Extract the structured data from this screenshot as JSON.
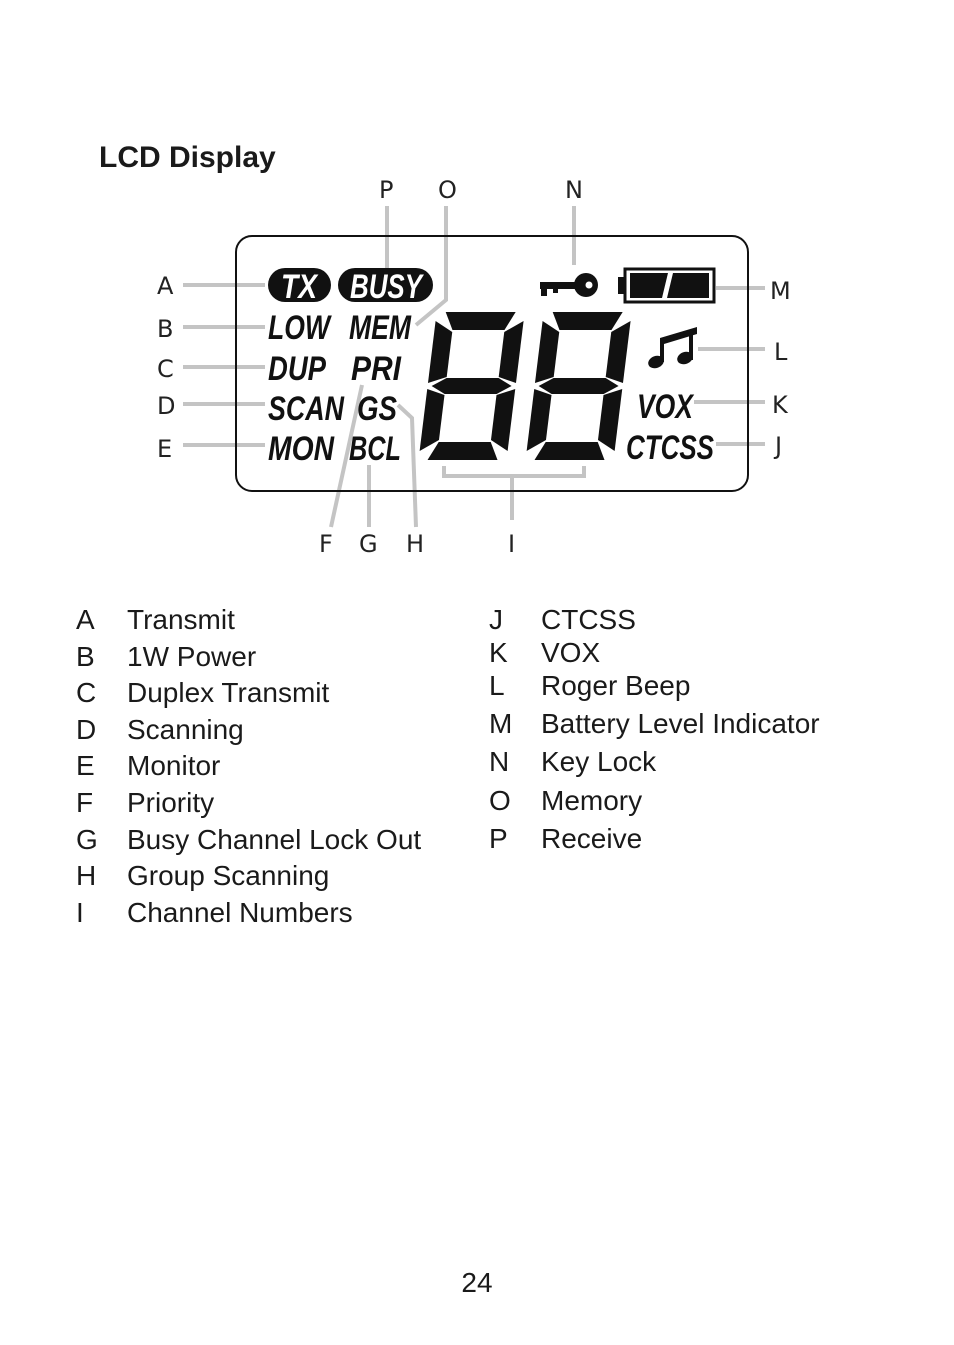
{
  "section_title": "LCD Display",
  "lcd": {
    "indicators": {
      "tx": "TX",
      "busy": "BUSY",
      "low": "LOW",
      "mem": "MEM",
      "dup": "DUP",
      "pri": "PRI",
      "scan": "SCAN",
      "gs": "GS",
      "mon": "MON",
      "bcl": "BCL",
      "vox": "VOX",
      "ctcss": "CTCSS"
    },
    "channel_digits": "88",
    "icons": [
      "key-icon",
      "battery-icon",
      "music-note-icon"
    ],
    "battery_level": 1.0
  },
  "callouts": {
    "A": "A",
    "B": "B",
    "C": "C",
    "D": "D",
    "E": "E",
    "F": "F",
    "G": "G",
    "H": "H",
    "I": "I",
    "J": "J",
    "K": "K",
    "L": "L",
    "M": "M",
    "N": "N",
    "O": "O",
    "P": "P"
  },
  "legend_left": [
    {
      "letter": "A",
      "text": "Transmit"
    },
    {
      "letter": "B",
      "text": "1W Power"
    },
    {
      "letter": "C",
      "text": "Duplex Transmit"
    },
    {
      "letter": "D",
      "text": "Scanning"
    },
    {
      "letter": "E",
      "text": "Monitor"
    },
    {
      "letter": "F",
      "text": "Priority"
    },
    {
      "letter": "G",
      "text": "Busy Channel Lock Out"
    },
    {
      "letter": "H",
      "text": "Group Scanning"
    },
    {
      "letter": "I",
      "text": "Channel Numbers"
    }
  ],
  "legend_right": [
    {
      "letter": "J",
      "text": "CTCSS"
    },
    {
      "letter": "K",
      "text": "VOX"
    },
    {
      "letter": "L",
      "text": "Roger Beep"
    },
    {
      "letter": "M",
      "text": "Battery Level Indicator"
    },
    {
      "letter": "N",
      "text": "Key Lock"
    },
    {
      "letter": "O",
      "text": "Memory"
    },
    {
      "letter": "P",
      "text": "Receive"
    }
  ],
  "page_number": "24"
}
